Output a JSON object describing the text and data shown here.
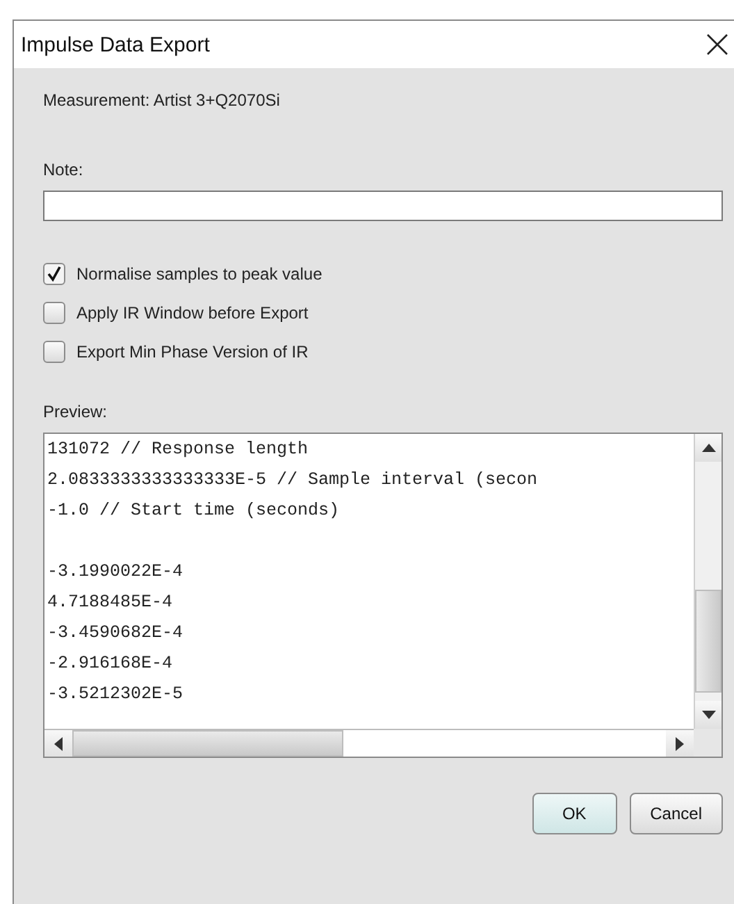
{
  "window": {
    "title": "Impulse Data Export"
  },
  "measurement": "Measurement: Artist 3+Q2070Si",
  "note": {
    "label": "Note:"
  },
  "options": [
    {
      "label": "Normalise samples to peak value",
      "checked": true
    },
    {
      "label": "Apply IR Window before Export",
      "checked": false
    },
    {
      "label": "Export Min Phase Version of IR",
      "checked": false
    }
  ],
  "preview": {
    "label": "Preview:",
    "header_lines": [
      "131072 // Response length",
      "2.0833333333333333E-5 // Sample interval (secon",
      "-1.0 // Start time (seconds)"
    ],
    "sample_lines": [
      "-3.1990022E-4",
      "4.7188485E-4",
      "-3.4590682E-4",
      "-2.916168E-4",
      "-3.5212302E-5"
    ]
  },
  "buttons": [
    {
      "label": "OK",
      "kind": "default"
    },
    {
      "label": "Cancel",
      "kind": "normal"
    }
  ]
}
